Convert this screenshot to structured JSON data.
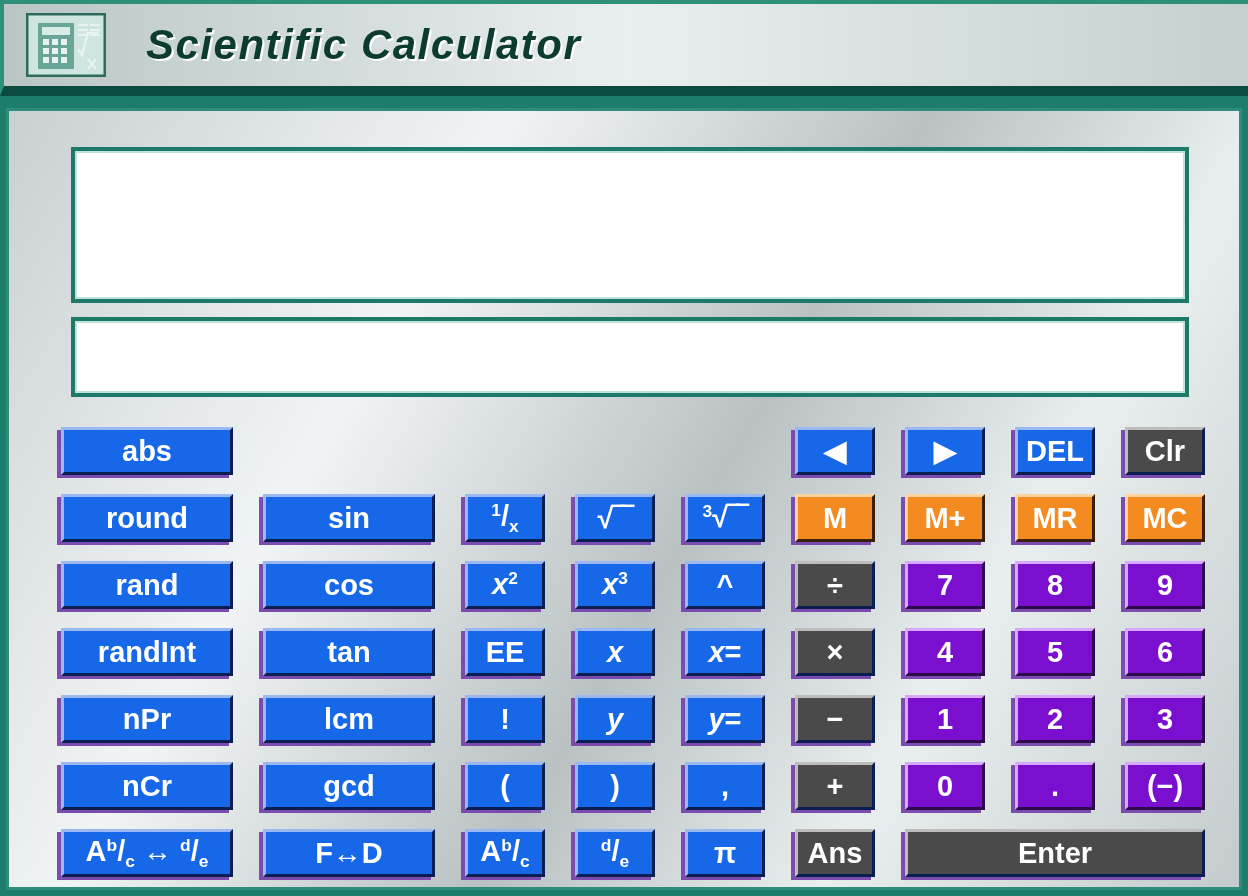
{
  "window": {
    "title": "Scientific Calculator"
  },
  "keypad": {
    "rows": [
      {
        "left": [
          {
            "label": "abs",
            "kind": "blue"
          }
        ],
        "right": [
          {
            "label": "◀",
            "kind": "blue"
          },
          {
            "label": "▶",
            "kind": "blue"
          },
          {
            "label": "DEL",
            "kind": "blue"
          },
          {
            "label": "Clr",
            "kind": "dark"
          }
        ]
      },
      {
        "left": [
          {
            "label": "round",
            "kind": "blue"
          },
          {
            "label": "sin",
            "kind": "blue"
          },
          {
            "label": "$^{1}$/$_{x}$",
            "kind": "blue"
          },
          {
            "label": "√‾‾",
            "kind": "blue"
          },
          {
            "label": "$^{3}$√‾‾",
            "kind": "blue"
          },
          {
            "label": "M",
            "kind": "orange"
          },
          {
            "label": "M+",
            "kind": "orange"
          },
          {
            "label": "MR",
            "kind": "orange"
          },
          {
            "label": "MC",
            "kind": "orange"
          }
        ],
        "right": []
      },
      {
        "left": [
          {
            "label": "rand",
            "kind": "blue"
          },
          {
            "label": "cos",
            "kind": "blue"
          },
          {
            "label": "*x*$^{2}$",
            "kind": "blue"
          },
          {
            "label": "*x*$^{3}$",
            "kind": "blue"
          },
          {
            "label": "^",
            "kind": "blue"
          },
          {
            "label": "÷",
            "kind": "dark"
          },
          {
            "label": "7",
            "kind": "purple"
          },
          {
            "label": "8",
            "kind": "purple"
          },
          {
            "label": "9",
            "kind": "purple"
          }
        ],
        "right": []
      },
      {
        "left": [
          {
            "label": "randInt",
            "kind": "blue"
          },
          {
            "label": "tan",
            "kind": "blue"
          },
          {
            "label": "EE",
            "kind": "blue"
          },
          {
            "label": "*x*",
            "kind": "blue"
          },
          {
            "label": "*x*=",
            "kind": "blue"
          },
          {
            "label": "×",
            "kind": "dark"
          },
          {
            "label": "4",
            "kind": "purple"
          },
          {
            "label": "5",
            "kind": "purple"
          },
          {
            "label": "6",
            "kind": "purple"
          }
        ],
        "right": []
      },
      {
        "left": [
          {
            "label": "nPr",
            "kind": "blue"
          },
          {
            "label": "lcm",
            "kind": "blue"
          },
          {
            "label": "!",
            "kind": "blue"
          },
          {
            "label": "*y*",
            "kind": "blue"
          },
          {
            "label": "*y*=",
            "kind": "blue"
          },
          {
            "label": "−",
            "kind": "dark"
          },
          {
            "label": "1",
            "kind": "purple"
          },
          {
            "label": "2",
            "kind": "purple"
          },
          {
            "label": "3",
            "kind": "purple"
          }
        ],
        "right": []
      },
      {
        "left": [
          {
            "label": "nCr",
            "kind": "blue"
          },
          {
            "label": "gcd",
            "kind": "blue"
          },
          {
            "label": "(",
            "kind": "blue"
          },
          {
            "label": ")",
            "kind": "blue"
          },
          {
            "label": ",",
            "kind": "blue"
          },
          {
            "label": "+",
            "kind": "dark"
          },
          {
            "label": "0",
            "kind": "purple"
          },
          {
            "label": ".",
            "kind": "purple"
          },
          {
            "label": "(−)",
            "kind": "purple"
          }
        ],
        "right": []
      },
      {
        "left": [
          {
            "label": "A$^{b}$/$_{c}$ ↔ $^{d}$/$_{e}$",
            "kind": "blue"
          },
          {
            "label": "F↔D",
            "kind": "blue"
          },
          {
            "label": "A$^{b}$/$_{c}$",
            "kind": "blue"
          },
          {
            "label": "$^{d}$/$_{e}$",
            "kind": "blue"
          },
          {
            "label": "π",
            "kind": "blue"
          },
          {
            "label": "Ans",
            "kind": "dark"
          }
        ],
        "right": [
          {
            "label": "Enter",
            "kind": "enter"
          }
        ]
      }
    ]
  }
}
